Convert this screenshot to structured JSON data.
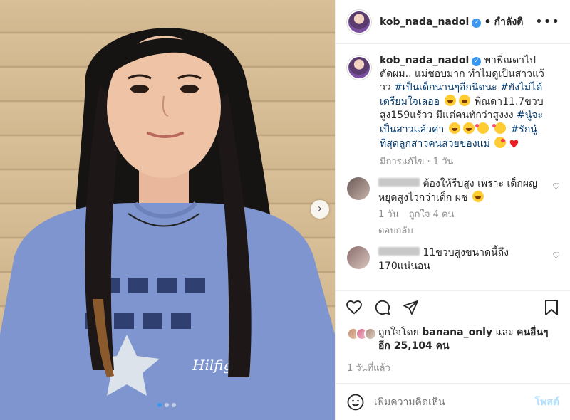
{
  "post": {
    "username": "kob_nada_nadol",
    "follow_label": "กำลังติดตาม",
    "more_label": "•••",
    "carousel_next": "›",
    "caption": {
      "username": "kob_nada_nadol",
      "text_1": "พาพี่ณดาไปตัดผม.. แม่ชอบมาก ทำไมดูเป็นสาวแว้วว",
      "tag_1": "#เป็นเด็กนานๆอีกนิดนะ",
      "tag_2": "#ยังไม่ได้เตรียมใจเลออ",
      "text_2": "พี่ณดา11.7ขวบ สูง159แร้วว มีแต่คนทักว่าสูงงง",
      "tag_3": "#นู๋จะเป็นสาวแล้วค่า",
      "tag_4": "#รักนู๋ที่สุดลูกสาวคนสวยของแม่",
      "edited": "มีการแก้ไข · 1 วัน"
    },
    "comments": [
      {
        "text": "ต้องให้รีบสูง เพราะ เด็กผญ หยุดสูงไวกว่าเด็ก ผช",
        "time": "1 วัน",
        "likes": "ถูกใจ 4 คน",
        "reply": "ตอบกลับ"
      },
      {
        "text": "11ขวบสูงขนาดนี้ถึง 170แน่นอน"
      }
    ],
    "likes": {
      "liked_by_prefix": "ถูกใจโดย",
      "liked_by_user": "banana_only",
      "and": "และ",
      "others": "คนอื่นๆ อีก 25,104 คน"
    },
    "time_ago": "1 วันที่แล้ว",
    "add_comment": {
      "placeholder": "เพิ่มความคิดเห็น",
      "post_label": "โพสต์"
    }
  },
  "icons": [
    "heart-icon",
    "comment-icon",
    "share-icon",
    "bookmark-icon",
    "emoji-icon",
    "verified-icon",
    "more-icon"
  ],
  "colors": {
    "link": "#00376b",
    "accent": "#3897f0",
    "muted": "#8e8e8e",
    "post_disabled": "#b2dffc"
  }
}
